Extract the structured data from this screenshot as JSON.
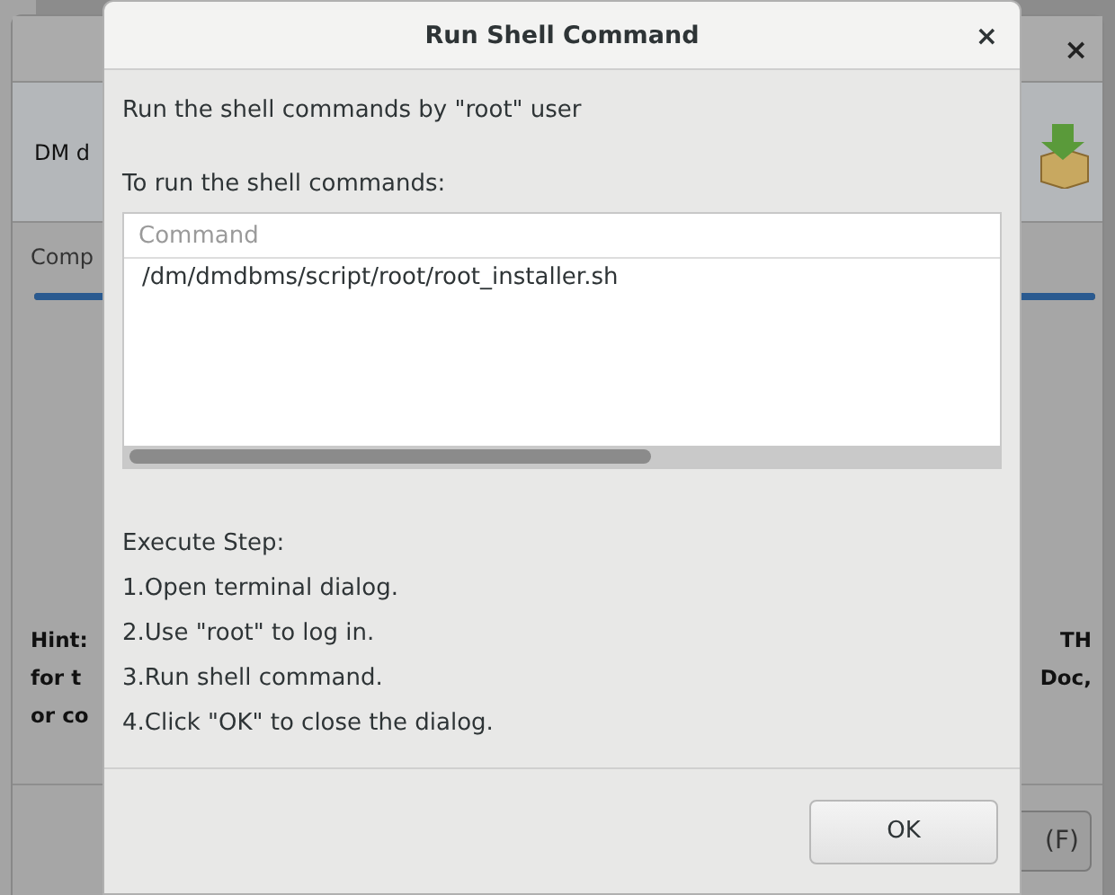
{
  "background_window": {
    "close_glyph": "×",
    "banner_text": "DM d",
    "progress_label": "Comp",
    "progress": {
      "level": 1
    },
    "hint_left": [
      "Hint:",
      "for t",
      "or co"
    ],
    "hint_right": [
      "TH",
      "Doc,"
    ],
    "button": "(F)"
  },
  "dialog": {
    "title": "Run Shell Command",
    "close_glyph": "×",
    "intro": "Run the shell commands by \"root\" user",
    "commands_label": "To run the shell commands:",
    "table": {
      "columns": [
        "Command"
      ],
      "rows": [
        "/dm/dmdbms/script/root/root_installer.sh"
      ]
    },
    "steps_title": "Execute Step:",
    "steps": [
      "1.Open terminal dialog.",
      "2.Use \"root\" to log in.",
      "3.Run shell command.",
      "4.Click \"OK\" to close the dialog."
    ],
    "ok_button": "OK"
  }
}
